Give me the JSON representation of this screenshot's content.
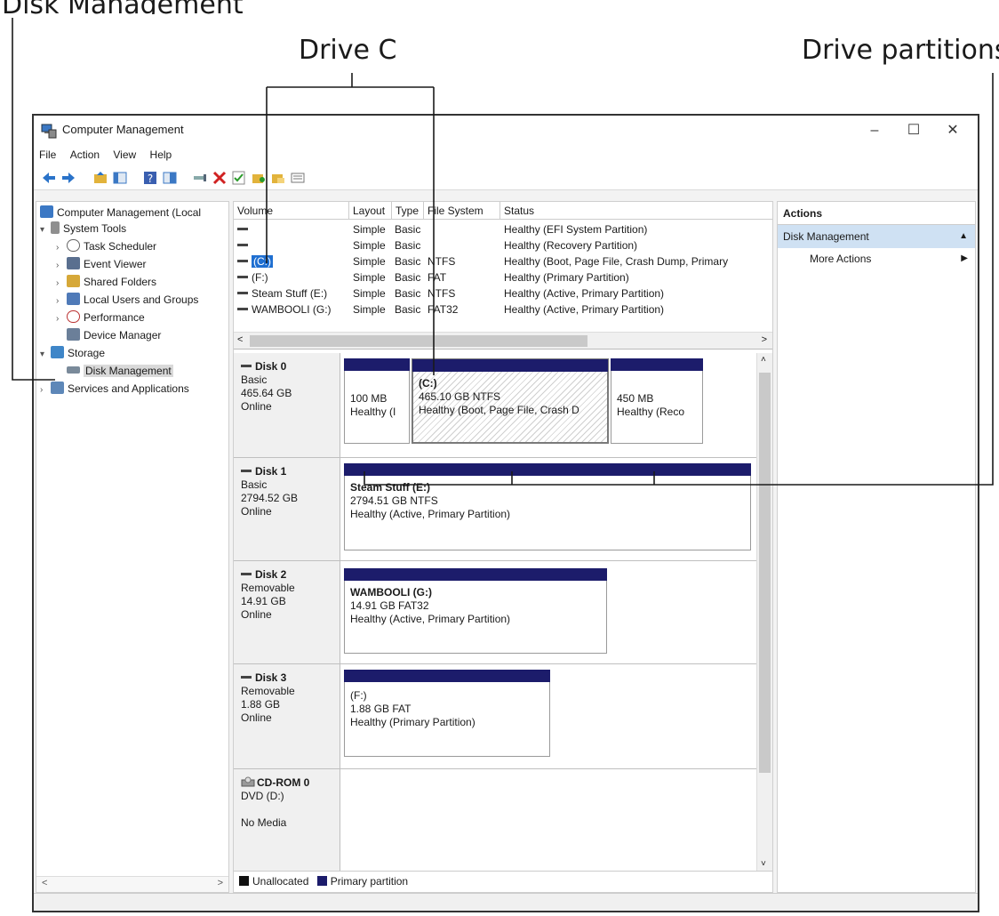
{
  "callouts": {
    "top_fragment": "Disk Management",
    "drive_c": "Drive C",
    "drive_partitions": "Drive partitions"
  },
  "window": {
    "title": "Computer Management",
    "minimize": "–",
    "maximize": "☐",
    "close": "✕"
  },
  "menu": [
    "File",
    "Action",
    "View",
    "Help"
  ],
  "tree": {
    "root": "Computer Management (Local",
    "items": [
      "System Tools",
      "Task Scheduler",
      "Event Viewer",
      "Shared Folders",
      "Local Users and Groups",
      "Performance",
      "Device Manager",
      "Storage",
      "Disk Management",
      "Services and Applications"
    ],
    "scroll_left": "<",
    "scroll_right": ">"
  },
  "volumes": {
    "headers": [
      "Volume",
      "Layout",
      "Type",
      "File System",
      "Status"
    ],
    "rows": [
      {
        "name": "",
        "layout": "Simple",
        "type": "Basic",
        "fs": "",
        "status": "Healthy (EFI System Partition)"
      },
      {
        "name": "",
        "layout": "Simple",
        "type": "Basic",
        "fs": "",
        "status": "Healthy (Recovery Partition)"
      },
      {
        "name": "(C:)",
        "layout": "Simple",
        "type": "Basic",
        "fs": "NTFS",
        "status": "Healthy (Boot, Page File, Crash Dump, Primary"
      },
      {
        "name": "(F:)",
        "layout": "Simple",
        "type": "Basic",
        "fs": "FAT",
        "status": "Healthy (Primary Partition)"
      },
      {
        "name": "Steam Stuff (E:)",
        "layout": "Simple",
        "type": "Basic",
        "fs": "NTFS",
        "status": "Healthy (Active, Primary Partition)"
      },
      {
        "name": "WAMBOOLI (G:)",
        "layout": "Simple",
        "type": "Basic",
        "fs": "FAT32",
        "status": "Healthy (Active, Primary Partition)"
      }
    ],
    "scroll_left": "<",
    "scroll_right": ">"
  },
  "disks": [
    {
      "name": "Disk 0",
      "kind": "Basic",
      "size": "465.64 GB",
      "state": "Online",
      "parts": [
        {
          "label": "",
          "line1": "100 MB",
          "line2": "Healthy (I"
        },
        {
          "label": "(C:)",
          "line1": "465.10 GB NTFS",
          "line2": "Healthy (Boot, Page File, Crash D"
        },
        {
          "label": "",
          "line1": "450 MB",
          "line2": "Healthy (Reco"
        }
      ]
    },
    {
      "name": "Disk 1",
      "kind": "Basic",
      "size": "2794.52 GB",
      "state": "Online",
      "parts": [
        {
          "label": "Steam Stuff  (E:)",
          "line1": "2794.51 GB NTFS",
          "line2": "Healthy (Active, Primary Partition)"
        }
      ]
    },
    {
      "name": "Disk 2",
      "kind": "Removable",
      "size": "14.91 GB",
      "state": "Online",
      "parts": [
        {
          "label": "WAMBOOLI  (G:)",
          "line1": "14.91 GB FAT32",
          "line2": "Healthy (Active, Primary Partition)"
        }
      ]
    },
    {
      "name": "Disk 3",
      "kind": "Removable",
      "size": "1.88 GB",
      "state": "Online",
      "parts": [
        {
          "label": "(F:)",
          "line1": "1.88 GB FAT",
          "line2": "Healthy (Primary Partition)"
        }
      ]
    },
    {
      "name": "CD-ROM 0",
      "kind": "DVD (D:)",
      "size": "",
      "state": "No Media",
      "parts": []
    }
  ],
  "legend": {
    "unallocated": "Unallocated",
    "primary": "Primary partition"
  },
  "actions": {
    "header": "Actions",
    "section": "Disk Management",
    "more": "More Actions"
  },
  "colors": {
    "partition_bar": "#1c1c6b",
    "selection": "#1f6fd1",
    "actions_section": "#cfe1f3"
  }
}
